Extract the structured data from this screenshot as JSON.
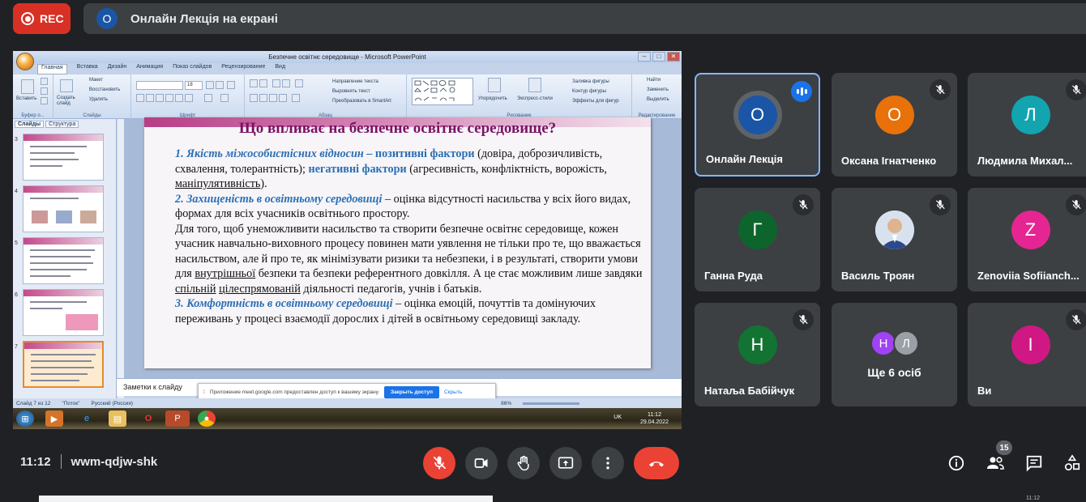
{
  "rec_label": "REC",
  "presenting": {
    "avatar_letter": "O",
    "title": "Онлайн Лекція на екрані"
  },
  "powerpoint": {
    "window_title": "Безпечне освітнє середовище - Microsoft PowerPoint",
    "tabs": [
      "Главная",
      "Вставка",
      "Дизайн",
      "Анимация",
      "Показ слайдов",
      "Рецензирование",
      "Вид"
    ],
    "groups": {
      "clipboard": {
        "caption": "Буфер о...",
        "paste": "Вставить"
      },
      "slides": {
        "caption": "Слайды",
        "create": "Создать слайд",
        "layout": "Макет",
        "reset": "Восстановить",
        "delete": "Удалить"
      },
      "font": {
        "caption": "Шрифт",
        "size": "18"
      },
      "paragraph": {
        "caption": "Абзац",
        "text_dir": "Направление текста",
        "align": "Выровнять текст",
        "smartart": "Преобразовать в SmartArt"
      },
      "drawing": {
        "caption": "Рисование",
        "arrange": "Упорядочить",
        "styles": "Экспресс-стили",
        "fill": "Заливка фигуры",
        "outline": "Контур фигуры",
        "effects": "Эффекты для фигур"
      },
      "editing": {
        "caption": "Редактирование",
        "find": "Найти",
        "replace": "Заменить",
        "select": "Выделить"
      }
    },
    "pane_tabs": [
      "Слайды",
      "Структура"
    ],
    "thumbnails": [
      {
        "num": "3",
        "selected": false
      },
      {
        "num": "4",
        "selected": false
      },
      {
        "num": "5",
        "selected": false
      },
      {
        "num": "6",
        "selected": false
      },
      {
        "num": "7",
        "selected": true
      }
    ],
    "slide": {
      "title": "Що впливає на безпечне освітнє середовище?",
      "p1_head": "1. Якість міжособистісних відносин – ",
      "p1_pos": "позитивні фактори",
      "p1_a": " (довіра, доброзичливість, схвалення, толерантність); ",
      "p1_neg": "негативні фактори",
      "p1_b": " (агресивність, конфліктність, ворожість, ",
      "p1_u": "маніпулятивність",
      "p1_c": ").",
      "p2_head": "2. Захищеність в освітньому середовищі",
      "p2_a": " – оцінка відсутності насильства у всіх його видах, формах для всіх учасників освітнього простору.",
      "p2_b": "Для того, щоб унеможливити насильство та створити безпечне освітнє середовище, кожен учасник навчально-виховного процесу повинен мати уявлення не тільки про те, що вважається насильством, але й про те, як мінімізувати ризики та небезпеки, і в результаті, створити умови для ",
      "p2_u1": "внутрішньої",
      "p2_c": " безпеки та безпеки референтного довкілля. А це стає можливим лише завдяки ",
      "p2_u2": "спільній",
      "p2_sp": " ",
      "p2_u3": "цілеспрямованій",
      "p2_d": " діяльності педагогів, учнів і батьків.",
      "p3_head": "3. Комфортність в освітньому середовищі",
      "p3_a": " – оцінка емоцій, почуттів та домінуючих переживань у процесі взаємодії дорослих і дітей в освітньому середовищі закладу."
    },
    "notes_placeholder": "Заметки к слайду",
    "share_notice": {
      "text": "Приложение meet.google.com предоставлен доступ к вашему экрану.",
      "stop": "Закрыть доступ",
      "hide": "Скрыть"
    },
    "status": {
      "slide": "Слайд 7 из 12",
      "theme": "\"Поток\"",
      "lang": "Русский (Россия)",
      "zoom": "86%"
    },
    "taskbar": {
      "lang": "UK",
      "time": "11:12",
      "date": "29.04.2022"
    }
  },
  "tiles": [
    {
      "name": "Онлайн Лекція",
      "letter": "O",
      "color": "#1a56a5",
      "speaking": true
    },
    {
      "name": "Оксана Ігнатченко",
      "letter": "О",
      "color": "#e8710a",
      "speaking": false
    },
    {
      "name": "Людмила Михал...",
      "letter": "Л",
      "color": "#12a4af",
      "speaking": false
    },
    {
      "name": "Ганна Руда",
      "letter": "Г",
      "color": "#0d652d",
      "speaking": false
    },
    {
      "name": "Василь Троян",
      "letter": "",
      "color": "#c6d4e6",
      "speaking": false
    },
    {
      "name": "Zenoviia Sofiianch...",
      "letter": "Z",
      "color": "#e52592",
      "speaking": false
    },
    {
      "name": "Натаља Бабійчук",
      "letter": "Н",
      "color": "#137333",
      "speaking": false
    },
    {
      "name": "Ще 6 осіб",
      "letter": "",
      "color": "",
      "speaking": false
    },
    {
      "name": "Ви",
      "letter": "І",
      "color": "#d01884",
      "speaking": false
    }
  ],
  "more_avatars": [
    "Н",
    "Л"
  ],
  "meeting": {
    "time": "11:12",
    "code": "wwm-qdjw-shk"
  },
  "participants_count": "15",
  "colors": {
    "end_call": "#ea4335",
    "accent": "#8ab4f8",
    "brand_blue": "#1a73e8"
  }
}
